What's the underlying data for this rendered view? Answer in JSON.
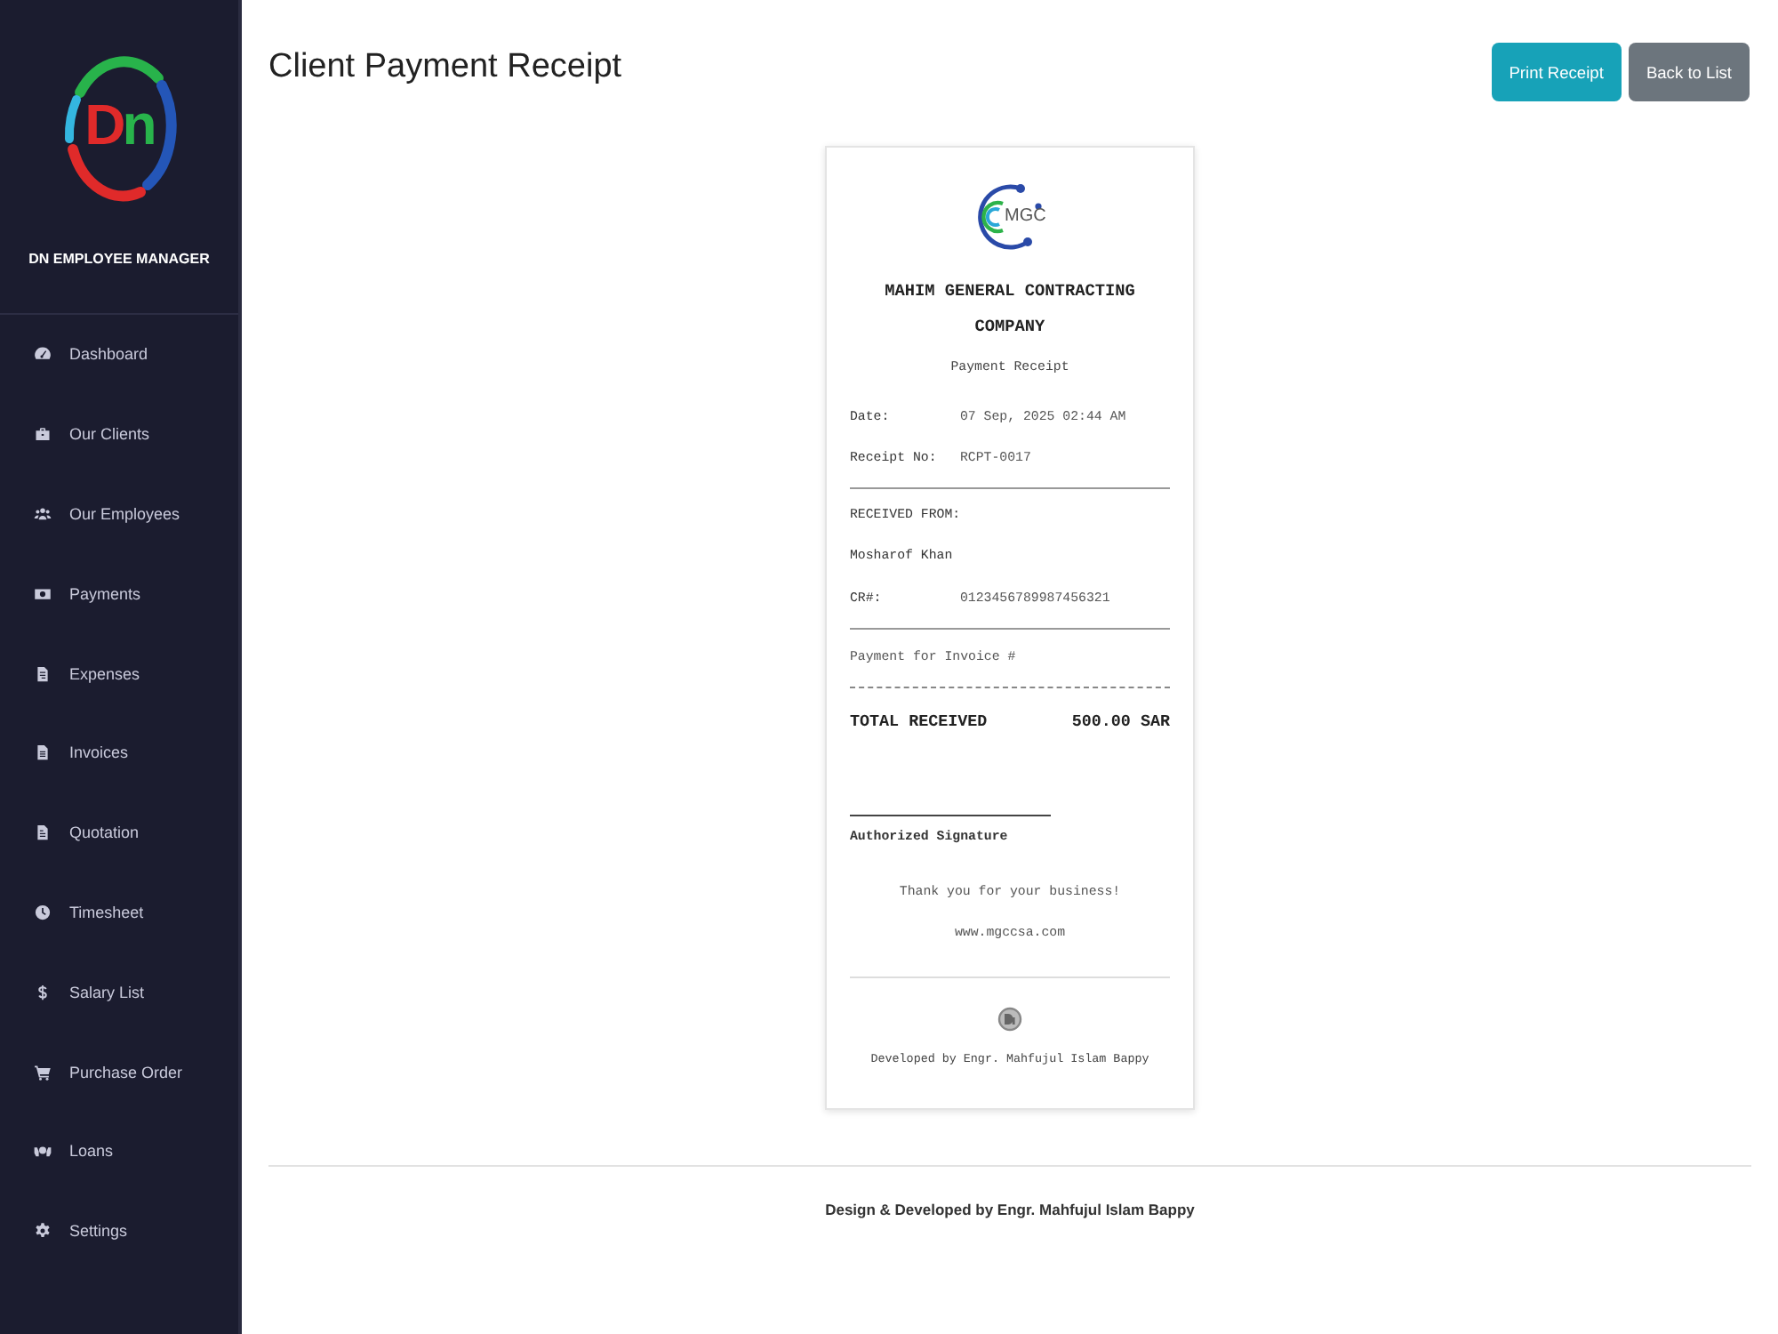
{
  "sidebar": {
    "logo_text": "Dn",
    "brand": "DN EMPLOYEE MANAGER",
    "items": [
      {
        "label": "Dashboard"
      },
      {
        "label": "Our Clients"
      },
      {
        "label": "Our Employees"
      },
      {
        "label": "Payments"
      },
      {
        "label": "Expenses"
      },
      {
        "label": "Invoices"
      },
      {
        "label": "Quotation"
      },
      {
        "label": "Timesheet"
      },
      {
        "label": "Salary List"
      },
      {
        "label": "Purchase Order"
      },
      {
        "label": "Loans"
      },
      {
        "label": "Settings"
      }
    ]
  },
  "header": {
    "title": "Client Payment Receipt",
    "buttons": [
      {
        "label": "Print Receipt",
        "kind": "primary"
      },
      {
        "label": "Back to List",
        "kind": "secondary"
      }
    ]
  },
  "receipt": {
    "logo_text": "MGC",
    "company": "MAHIM GENERAL CONTRACTING COMPANY",
    "subtitle": "Payment Receipt",
    "details": [
      {
        "label": "Date:",
        "value": "07 Sep, 2025 02:44 AM"
      },
      {
        "label": "Receipt No:",
        "value": "RCPT-0017"
      }
    ],
    "received_from_label": "RECEIVED FROM:",
    "client_name": "Mosharof Khan",
    "cr": {
      "label": "CR#:",
      "value": "0123456789987456321"
    },
    "payment_for": "Payment for Invoice #",
    "total": {
      "label": "TOTAL RECEIVED",
      "value": "500.00 SAR"
    },
    "signature_label": "Authorized Signature",
    "thank_you": "Thank you for your business!",
    "website": "www.mgccsa.com",
    "developer_credit": "Developed by Engr. Mahfujul Islam Bappy"
  },
  "footer": {
    "text": "Design & Developed by Engr. Mahfujul Islam Bappy"
  }
}
